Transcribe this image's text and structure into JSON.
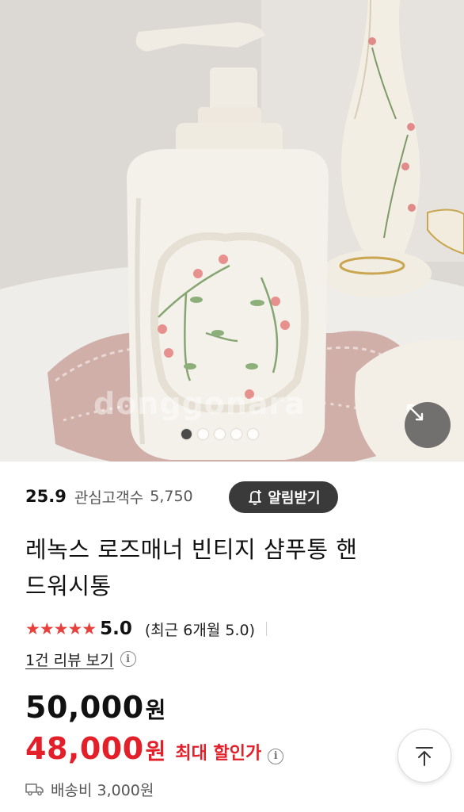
{
  "product_image": {
    "watermark": "donggonara",
    "carousel_total": 5,
    "carousel_active_index": 1
  },
  "stats": {
    "rating": "25.9",
    "interest_label": "관심고객수",
    "interest_count": "5,750"
  },
  "alert_button": {
    "label": "알림받기"
  },
  "product": {
    "title_line1": "레녹스 로즈매너 빈티지 샴푸통 핸",
    "title_line2": "드워시통"
  },
  "review": {
    "stars": "★★★★★",
    "score": "5.0",
    "recent": "(최근 6개월 5.0)",
    "link_label": "1건 리뷰 보기"
  },
  "price": {
    "original": "50,000",
    "original_unit": "원",
    "sale": "48,000",
    "sale_unit": "원",
    "sale_label": "최대 할인가"
  },
  "shipping": {
    "label": "배송비 3,000원"
  },
  "colors": {
    "accent_red": "#e3202a",
    "star_red": "#e8413c",
    "dark_button": "#3a3a3a"
  },
  "icons": {
    "expand": "expand-arrows-icon",
    "bell": "bell-plus-icon",
    "info": "info-icon",
    "truck": "truck-icon",
    "scroll_top": "arrow-up-icon"
  }
}
